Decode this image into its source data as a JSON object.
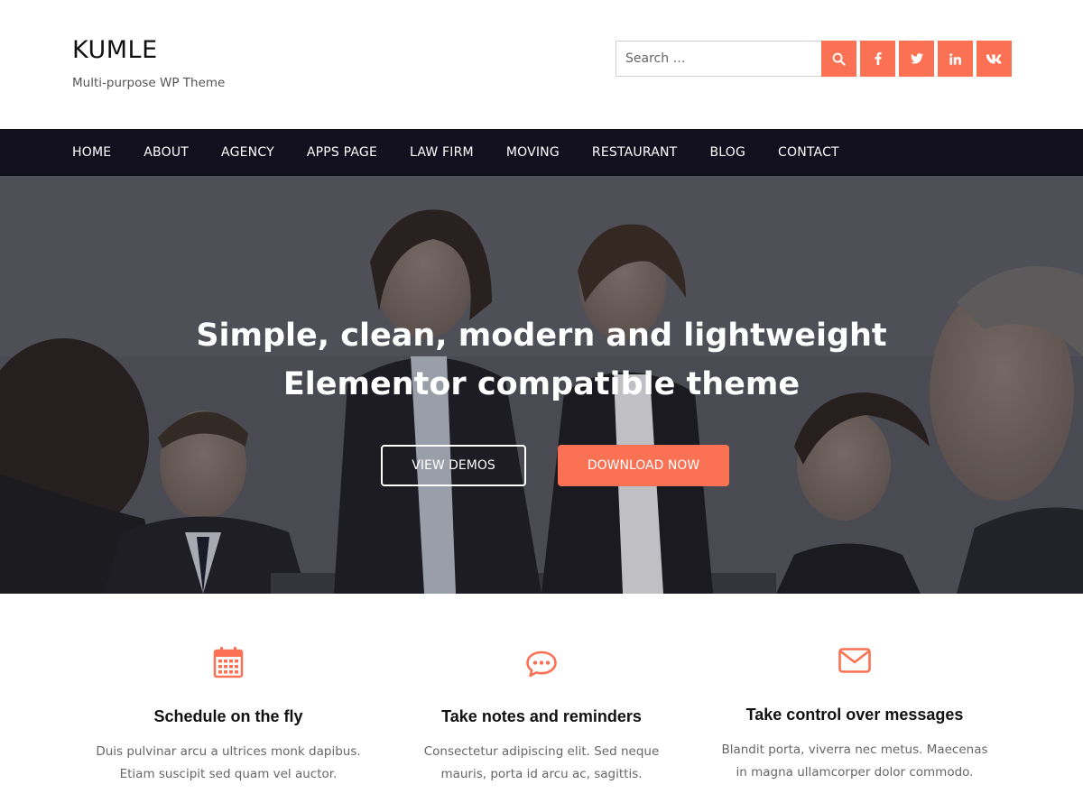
{
  "site": {
    "title": "KUMLE",
    "tagline": "Multi-purpose WP Theme"
  },
  "search": {
    "placeholder": "Search …"
  },
  "header_icons": [
    "search-icon",
    "facebook-icon",
    "twitter-icon",
    "linkedin-icon",
    "vk-icon"
  ],
  "nav": {
    "items": [
      {
        "label": "HOME"
      },
      {
        "label": "ABOUT"
      },
      {
        "label": "AGENCY"
      },
      {
        "label": "APPS PAGE"
      },
      {
        "label": "LAW FIRM"
      },
      {
        "label": "MOVING"
      },
      {
        "label": "RESTAURANT"
      },
      {
        "label": "BLOG"
      },
      {
        "label": "CONTACT"
      }
    ]
  },
  "hero": {
    "title_line1": "Simple, clean, modern and lightweight",
    "title_line2": "Elementor compatible theme",
    "view_demos_label": "VIEW DEMOS",
    "download_label": "DOWNLOAD NOW"
  },
  "features": [
    {
      "icon": "calendar-icon",
      "title": "Schedule on the fly",
      "line1": "Duis pulvinar arcu a ultrices monk dapibus.",
      "line2": "Etiam suscipit sed quam vel auctor."
    },
    {
      "icon": "chat-bubble-icon",
      "title": "Take notes and reminders",
      "line1": "Consectetur adipiscing elit. Sed neque",
      "line2": "mauris, porta id arcu ac, sagittis."
    },
    {
      "icon": "envelope-icon",
      "title": "Take control over messages",
      "line1": "Blandit porta, viverra nec metus. Maecenas",
      "line2": "in magna ullamcorper dolor commodo."
    }
  ],
  "colors": {
    "accent": "#fa7154",
    "nav_background": "#12101f",
    "text_dark": "#111111",
    "text_muted": "#666666"
  }
}
